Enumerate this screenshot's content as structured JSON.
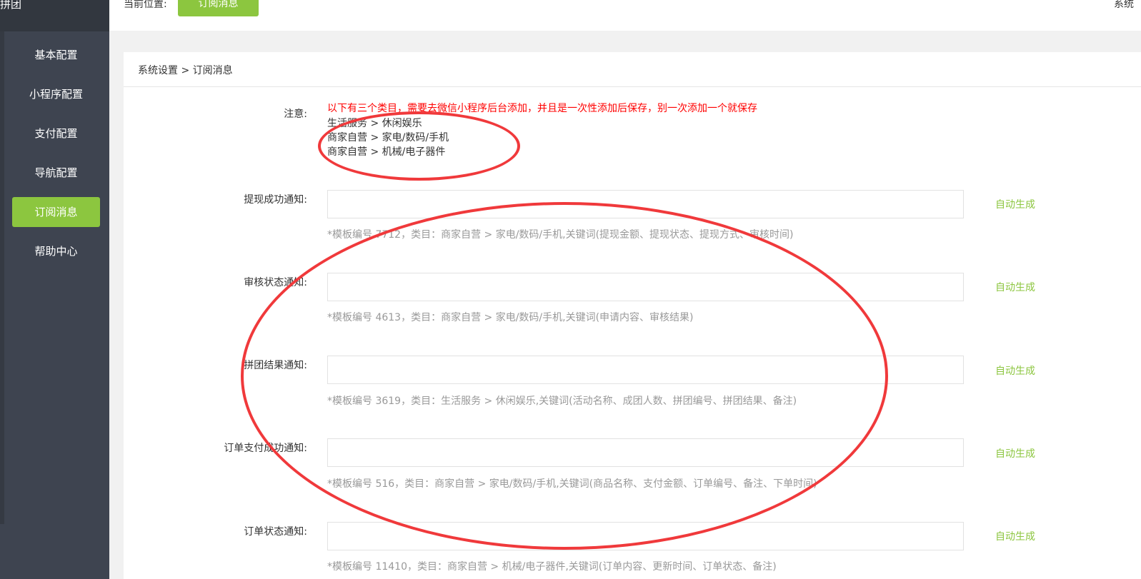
{
  "sidebar": {
    "brand": "拼团",
    "items": [
      {
        "label": "基本配置"
      },
      {
        "label": "小程序配置"
      },
      {
        "label": "支付配置"
      },
      {
        "label": "导航配置"
      },
      {
        "label": "订阅消息"
      },
      {
        "label": "帮助中心"
      }
    ]
  },
  "topbar": {
    "location_label": "当前位置:",
    "location_button": "订阅消息",
    "right_text": "系统"
  },
  "panel": {
    "breadcrumb": "系统设置 > 订阅消息",
    "note": {
      "label": "注意:",
      "warning": "以下有三个类目，需要去微信小程序后台添加，并且是一次性添加后保存，别一次添加一个就保存",
      "lines": [
        "生活服务 > 休闲娱乐",
        "商家自营 > 家电/数码/手机",
        "商家自营 > 机械/电子器件"
      ]
    },
    "fields": [
      {
        "label": "提现成功通知:",
        "value": "",
        "hint": "*模板编号 7712，类目：商家自营 > 家电/数码/手机,关键词(提现金额、提现状态、提现方式、审核时间)",
        "action": "自动生成"
      },
      {
        "label": "审核状态通知:",
        "value": "",
        "hint": "*模板编号 4613，类目：商家自营 > 家电/数码/手机,关键词(申请内容、审核结果)",
        "action": "自动生成"
      },
      {
        "label": "拼团结果通知:",
        "value": "",
        "hint": "*模板编号 3619，类目：生活服务 > 休闲娱乐,关键词(活动名称、成团人数、拼团编号、拼团结果、备注)",
        "action": "自动生成"
      },
      {
        "label": "订单支付成功通知:",
        "value": "",
        "hint": "*模板编号 516，类目：商家自营 > 家电/数码/手机,关键词(商品名称、支付金额、订单编号、备注、下单时间)",
        "action": "自动生成"
      },
      {
        "label": "订单状态通知:",
        "value": "",
        "hint": "*模板编号 11410，类目：商家自营 > 机械/电子器件,关键词(订单内容、更新时间、订单状态、备注)",
        "action": "自动生成"
      }
    ]
  },
  "colors": {
    "accent": "#8cc63f",
    "sidebar": "#3e4450",
    "warning": "#ff0000",
    "annotation": "#f0393b"
  }
}
